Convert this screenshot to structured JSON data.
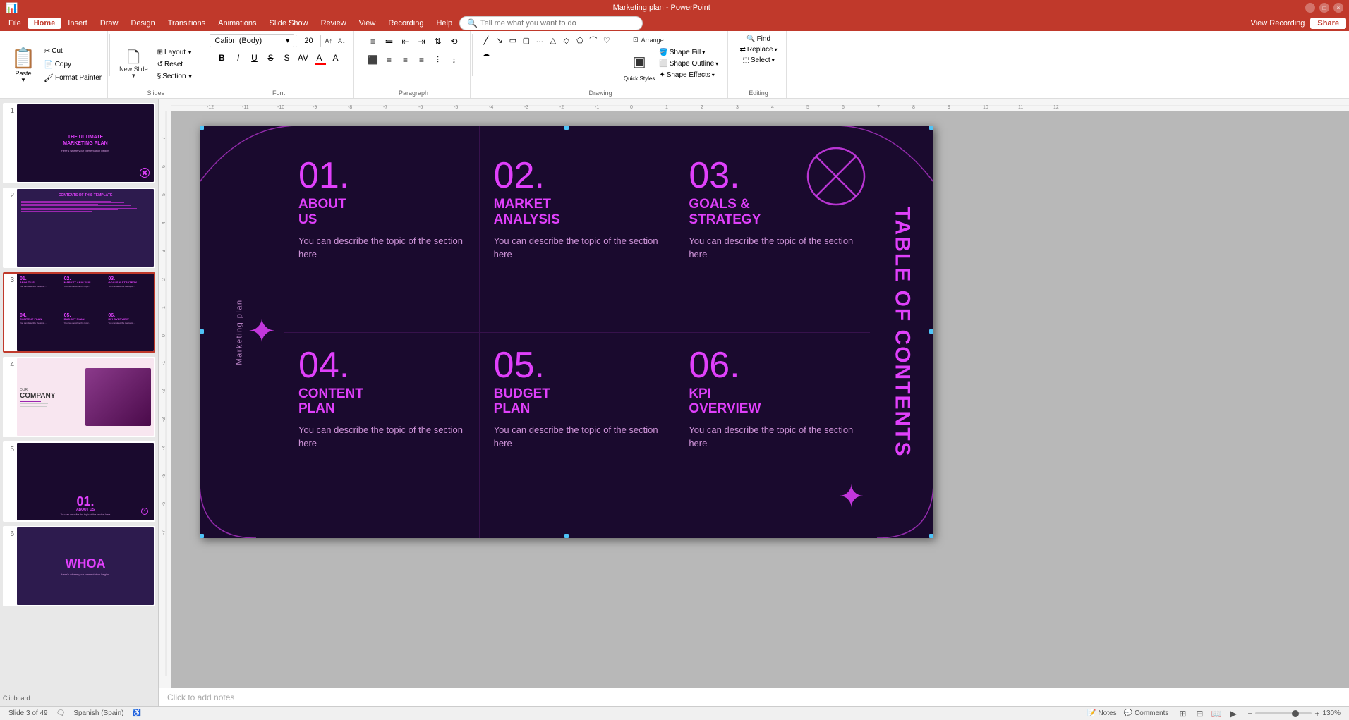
{
  "app": {
    "title": "Marketing plan - PowerPoint",
    "version": "PowerPoint"
  },
  "menu": {
    "items": [
      "File",
      "Home",
      "Insert",
      "Draw",
      "Design",
      "Transitions",
      "Animations",
      "Slide Show",
      "Review",
      "View",
      "Recording",
      "Help"
    ]
  },
  "ribbon": {
    "clipboard": {
      "paste_label": "Paste",
      "cut_label": "Cut",
      "copy_label": "Copy",
      "format_painter_label": "Format Painter",
      "group_label": "Clipboard"
    },
    "slides": {
      "new_slide_label": "New Slide",
      "layout_label": "Layout",
      "reset_label": "Reset",
      "section_label": "Section",
      "group_label": "Slides"
    },
    "font": {
      "font_name": "Calibri (Body)",
      "font_size": "20",
      "bold": "B",
      "italic": "I",
      "underline": "U",
      "strikethrough": "S",
      "shadow": "S",
      "group_label": "Font"
    },
    "paragraph": {
      "group_label": "Paragraph"
    },
    "drawing": {
      "arrange_label": "Arrange",
      "quick_styles_label": "Quick Styles",
      "shape_effects_label": "Shape Effects",
      "shape_fill_label": "Shape Fill",
      "shape_outline_label": "Shape Outline",
      "group_label": "Drawing"
    },
    "editing": {
      "find_label": "Find",
      "replace_label": "Replace",
      "select_label": "Select",
      "group_label": "Editing"
    }
  },
  "toolbar": {
    "search_placeholder": "Tell me what you want to do",
    "share_label": "Share",
    "view_recording_label": "View Recording"
  },
  "slides_panel": {
    "slides": [
      {
        "number": 1,
        "title": "THE ULTIMATE MARKETING PLAN",
        "type": "title"
      },
      {
        "number": 2,
        "title": "CONTENTS OF THIS TEMPLATE",
        "type": "contents"
      },
      {
        "number": 3,
        "title": "TABLE OF CONTENTS",
        "type": "toc",
        "active": true
      },
      {
        "number": 4,
        "title": "OUR COMPANY",
        "type": "company"
      },
      {
        "number": 5,
        "title": "01. ABOUT US",
        "type": "about"
      },
      {
        "number": 6,
        "title": "WHOA",
        "type": "whoa"
      }
    ]
  },
  "main_slide": {
    "background_color": "#1a0a2e",
    "accent_color": "#e040fb",
    "text_color": "#ce93d8",
    "side_label": "Marketing plan",
    "toc_label": "TABLE OF CONTENTS",
    "items": [
      {
        "number": "01.",
        "title": "ABOUT\nUS",
        "description": "You can describe the topic of the section here"
      },
      {
        "number": "02.",
        "title": "MARKET\nANALYSIS",
        "description": "You can describe the topic of the section here"
      },
      {
        "number": "03.",
        "title": "GOALS &\nSTRATEGY",
        "description": "You can describe the topic of the section here"
      },
      {
        "number": "04.",
        "title": "CONTENT\nPLAN",
        "description": "You can describe the topic of the section here"
      },
      {
        "number": "05.",
        "title": "BUDGET\nPLAN",
        "description": "You can describe the topic of the section here"
      },
      {
        "number": "06.",
        "title": "KPI\nOVERVIEW",
        "description": "You can describe the topic of the section here"
      }
    ]
  },
  "status_bar": {
    "slide_info": "Slide 3 of 49",
    "language": "Spanish (Spain)",
    "notes_label": "Notes",
    "comments_label": "Comments",
    "zoom_level": "130%"
  },
  "notes_area": {
    "placeholder": "Click to add notes"
  }
}
